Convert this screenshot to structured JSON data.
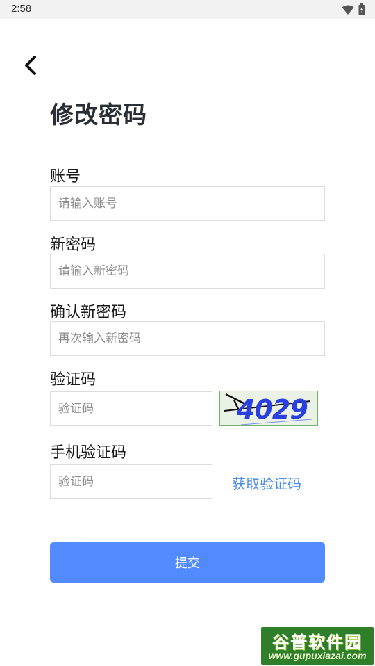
{
  "status_bar": {
    "time": "2:58",
    "icons": [
      "wifi-icon",
      "battery-icon"
    ]
  },
  "header": {
    "back_icon": "chevron-left-icon",
    "title": "修改密码"
  },
  "form": {
    "account": {
      "label": "账号",
      "placeholder": "请输入账号",
      "value": ""
    },
    "new_password": {
      "label": "新密码",
      "placeholder": "请输入新密码",
      "value": ""
    },
    "confirm_password": {
      "label": "确认新密码",
      "placeholder": "再次输入新密码",
      "value": ""
    },
    "captcha": {
      "label": "验证码",
      "placeholder": "验证码",
      "value": "",
      "image_text": "4029"
    },
    "sms_code": {
      "label": "手机验证码",
      "placeholder": "验证码",
      "value": "",
      "get_code_label": "获取验证码"
    }
  },
  "submit": {
    "label": "提交"
  },
  "watermark": {
    "title": "谷普软件园",
    "url": "www.gupuxiazai.com"
  },
  "colors": {
    "primary": "#528BFF",
    "link": "#4D8DE6",
    "title": "#2A2F36",
    "captcha_text": "#2A3FE0"
  }
}
